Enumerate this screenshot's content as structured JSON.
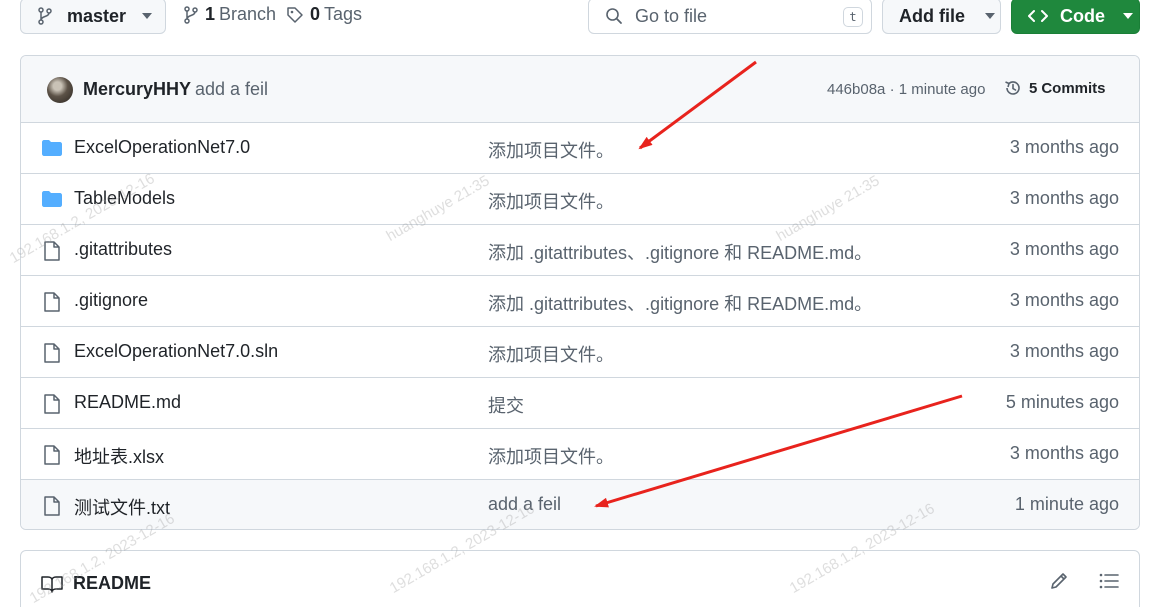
{
  "toolbar": {
    "branch_name": "master",
    "branches_count": "1",
    "branches_label": "Branch",
    "tags_count": "0",
    "tags_label": "Tags",
    "search_placeholder": "Go to file",
    "search_shortcut": "t",
    "add_file_label": "Add file",
    "code_label": "Code"
  },
  "latest_commit": {
    "author": "MercuryHHY",
    "message": "add a feil",
    "meta": "446b08a · 1 minute ago",
    "commits_count": "5",
    "commits_label": "Commits"
  },
  "files": [
    {
      "type": "folder",
      "name": "ExcelOperationNet7.0",
      "message": "添加项目文件。",
      "date": "3 months ago"
    },
    {
      "type": "folder",
      "name": "TableModels",
      "message": "添加项目文件。",
      "date": "3 months ago"
    },
    {
      "type": "file",
      "name": ".gitattributes",
      "message": "添加 .gitattributes、.gitignore 和 README.md。",
      "date": "3 months ago"
    },
    {
      "type": "file",
      "name": ".gitignore",
      "message": "添加 .gitattributes、.gitignore 和 README.md。",
      "date": "3 months ago"
    },
    {
      "type": "file",
      "name": "ExcelOperationNet7.0.sln",
      "message": "添加项目文件。",
      "date": "3 months ago"
    },
    {
      "type": "file",
      "name": "README.md",
      "message": "提交",
      "date": "5 minutes ago"
    },
    {
      "type": "file",
      "name": "地址表.xlsx",
      "message": "添加项目文件。",
      "date": "3 months ago"
    },
    {
      "type": "file",
      "name": "测试文件.txt",
      "message": "add a feil",
      "date": "1 minute ago"
    }
  ],
  "readme": {
    "title": "README"
  },
  "watermark": {
    "user": "huanghuye",
    "ip": "192.168.1.2",
    "date": "2023-12-16",
    "time": "21:35"
  },
  "colors": {
    "code_button": "#1f883d",
    "folder_icon": "#54aeff",
    "annotation_arrow": "#e8231d"
  }
}
